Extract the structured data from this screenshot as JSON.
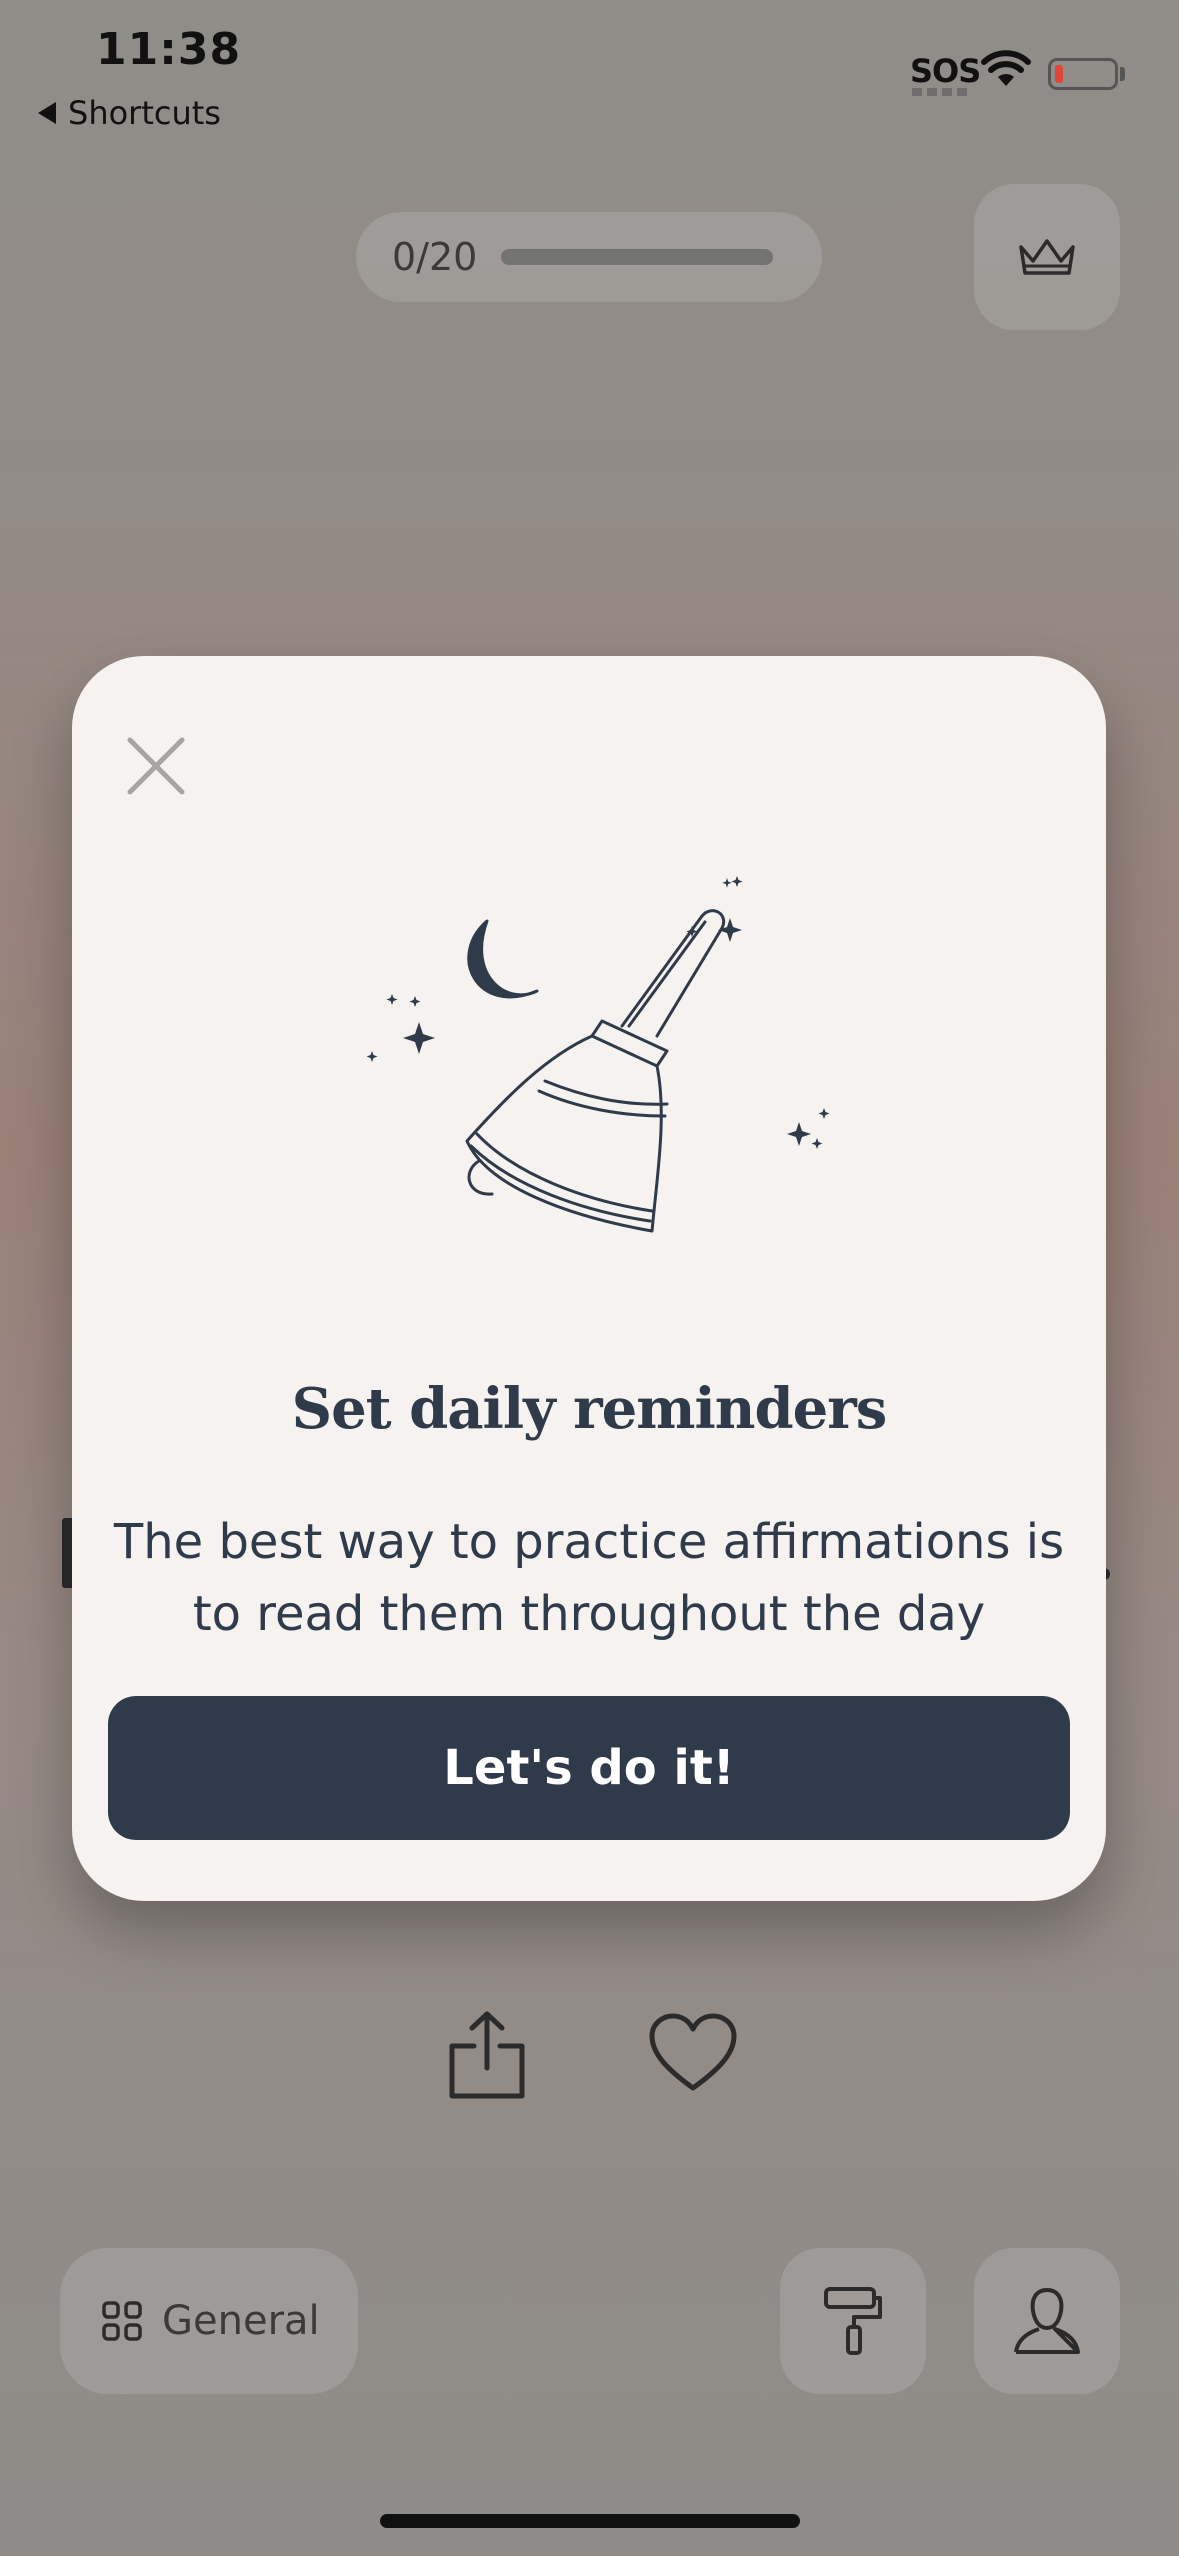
{
  "status_bar": {
    "time": "11:38",
    "back_label": "Shortcuts",
    "sos": "SOS",
    "battery_color": "#e0453a"
  },
  "progress": {
    "label": "0/20",
    "value": 0,
    "total": 20
  },
  "modal": {
    "title": "Set daily reminders",
    "body": "The best way to practice affirmations is to read them throughout the day",
    "cta_label": "Let's do it!",
    "illustration_icon": "bell-moon-stars-illustration"
  },
  "actions": {
    "share_icon": "share-icon",
    "favorite_icon": "heart-icon"
  },
  "bottom_bar": {
    "category_label": "General",
    "category_icon": "grid-icon",
    "theme_icon": "paint-roller-icon",
    "profile_icon": "person-icon"
  },
  "colors": {
    "accent": "#2f3a4b",
    "modal_bg": "#f6f2ef"
  }
}
